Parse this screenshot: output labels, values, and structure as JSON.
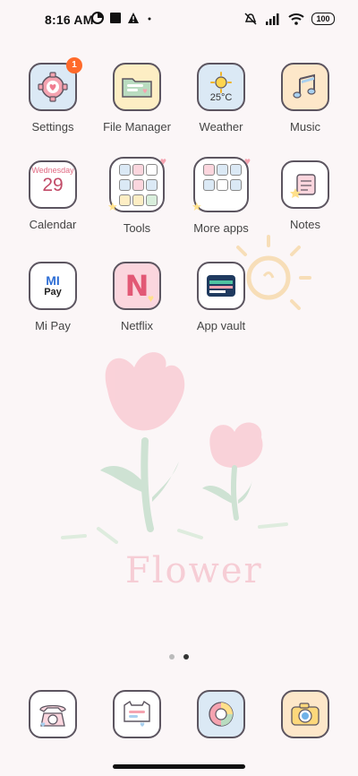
{
  "status": {
    "time": "8:16 AM",
    "battery": "100",
    "notification_icons": [
      "data-usage-icon",
      "square-icon",
      "warning-icon",
      "dot-icon"
    ],
    "system_icons": [
      "silent-icon",
      "signal-icon",
      "wifi-icon",
      "battery-icon"
    ]
  },
  "apps": [
    {
      "name": "settings",
      "label": "Settings",
      "badge": "1",
      "bg": "#dbe9f5"
    },
    {
      "name": "file-manager",
      "label": "File Manager",
      "bg": "#fdeec4"
    },
    {
      "name": "weather",
      "label": "Weather",
      "temp": "25°C",
      "bg": "#dbe9f5"
    },
    {
      "name": "music",
      "label": "Music",
      "bg": "#fde7c9"
    },
    {
      "name": "calendar",
      "label": "Calendar",
      "weekday": "Wednesday",
      "day": "29",
      "bg": "#ffffff"
    },
    {
      "name": "tools",
      "label": "Tools",
      "bg": "#ffffff"
    },
    {
      "name": "more-apps",
      "label": "More apps",
      "bg": "#ffffff"
    },
    {
      "name": "notes",
      "label": "Notes",
      "bg": "#ffffff"
    },
    {
      "name": "mi-pay",
      "label": "Mi Pay",
      "icon_text_top": "MI",
      "icon_text_bottom": "Pay",
      "bg": "#ffffff"
    },
    {
      "name": "netflix",
      "label": "Netflix",
      "icon_letter": "N",
      "bg": "#fbd6de"
    },
    {
      "name": "app-vault",
      "label": "App vault",
      "bg": "#ffffff"
    }
  ],
  "wallpaper_text": "Flower",
  "pages": {
    "count": 2,
    "active": 1
  },
  "dock": [
    {
      "name": "phone",
      "bg": "#ffffff"
    },
    {
      "name": "messages",
      "bg": "#ffffff"
    },
    {
      "name": "browser",
      "bg": "#dbe9f5"
    },
    {
      "name": "camera",
      "bg": "#fde7c9"
    }
  ],
  "colors": {
    "accent_badge": "#ff6a2a",
    "outline": "#5c5560",
    "wallpaper_bg": "#fbf6f7"
  }
}
